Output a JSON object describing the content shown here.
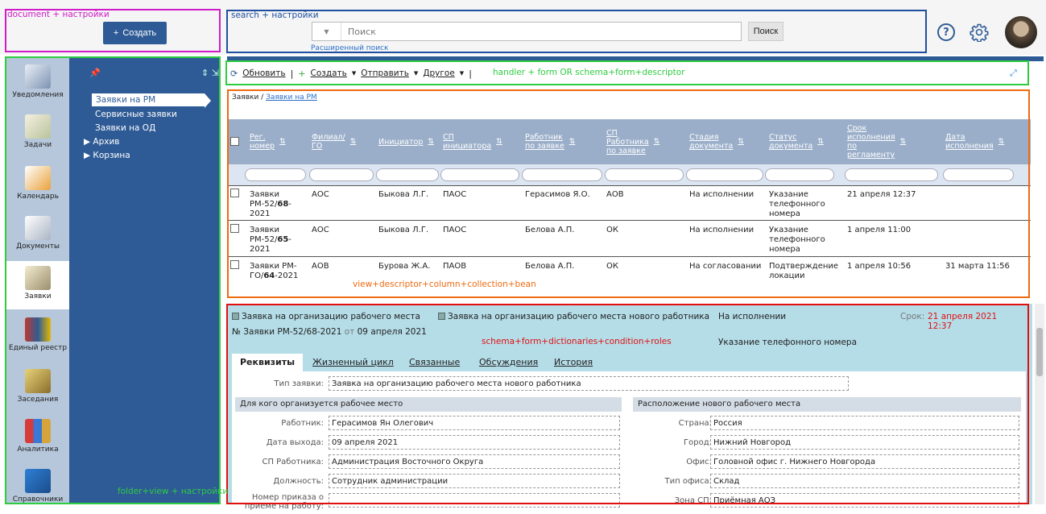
{
  "annotations": {
    "document": "document + настройки",
    "search": "search + настройки",
    "handler": "handler + form OR schema+form+descriptor",
    "folder": "folder+view + настройки",
    "view": "view+descriptor+column+collection+bean",
    "schema": "schema+form+dictionaries+condition+roles"
  },
  "header": {
    "create_label": "Создать",
    "search_placeholder": "Поиск",
    "search_button": "Поиск",
    "advanced_search": "Расширенный поиск",
    "help_glyph": "?"
  },
  "sidebar": {
    "items": [
      {
        "label": "Уведомления",
        "icon": "megaphone-icon"
      },
      {
        "label": "Задачи",
        "icon": "tasks-icon"
      },
      {
        "label": "Календарь",
        "icon": "calendar-icon"
      },
      {
        "label": "Документы",
        "icon": "documents-icon"
      },
      {
        "label": "Заявки",
        "icon": "requests-icon"
      },
      {
        "label": "Единый реестр",
        "icon": "registry-icon"
      },
      {
        "label": "Заседания",
        "icon": "meetings-icon"
      },
      {
        "label": "Аналитика",
        "icon": "analytics-icon"
      },
      {
        "label": "Справочники",
        "icon": "handbook-icon"
      }
    ]
  },
  "tree": {
    "items": [
      "Заявки на РМ",
      "Сервисные заявки",
      "Заявки на ОД",
      "Архив",
      "Корзина"
    ],
    "pin": "📌",
    "collapse": "⇕ ⇲"
  },
  "toolbar": {
    "refresh": "Обновить",
    "create": "Создать",
    "send": "Отправить",
    "other": "Другое",
    "sep": "|"
  },
  "breadcrumb": {
    "root": "Заявки",
    "sep": "/",
    "current": "Заявки на РМ"
  },
  "grid": {
    "columns": [
      "Рег.\nномер",
      "Филиал/\nГО",
      "Инициатор",
      "СП\nинициатора",
      "Работник\nпо заявке",
      "СП\nРаботника\nпо заявке",
      "Стадия\nдокумента",
      "Статус\nдокумента",
      "Срок\nисполнения\nпо\nрегламенту",
      "Дата\nисполнения"
    ],
    "rows": [
      {
        "num_pre": "Заявки\nРМ-52/",
        "num_bold": "68",
        "num_post": "-\n2021",
        "branch": "АОС",
        "initiator": "Быкова Л.Г.",
        "sp_init": "ПАОС",
        "worker": "Герасимов Я.О.",
        "sp_worker": "АОВ",
        "stage": "На исполнении",
        "status": "Указание\nтелефонного\nномера",
        "deadline": "21 апреля 12:37",
        "done": ""
      },
      {
        "num_pre": "Заявки\nРМ-52/",
        "num_bold": "65",
        "num_post": "-\n2021",
        "branch": "АОС",
        "initiator": "Быкова Л.Г.",
        "sp_init": "ПАОС",
        "worker": "Белова А.П.",
        "sp_worker": "ОК",
        "stage": "На исполнении",
        "status": "Указание\nтелефонного\nномера",
        "deadline": "1 апреля 11:00",
        "done": ""
      },
      {
        "num_pre": "Заявки РМ-\nГО/",
        "num_bold": "64",
        "num_post": "-2021",
        "branch": "АОВ",
        "initiator": "Бурова Ж.А.",
        "sp_init": "ПАОВ",
        "worker": "Белова А.П.",
        "sp_worker": "ОК",
        "stage": "На согласовании",
        "status": "Подтверждение\nлокации",
        "deadline": "1 апреля 10:56",
        "done": "31 марта 11:56"
      }
    ]
  },
  "detail": {
    "type1": "Заявка на организацию рабочего места",
    "type2": "Заявка на организацию рабочего места нового работника",
    "state": "На исполнении",
    "deadline_label": "Срок:",
    "deadline_value": "21 апреля 2021\n12:37",
    "number": "№ Заявки РМ-52/68-2021",
    "from": "от",
    "date": "09 апреля 2021",
    "status_text": "Указание телефонного номера",
    "tabs": [
      "Реквизиты",
      "Жизненный цикл",
      "Связанные",
      "Обсуждения",
      "История"
    ],
    "request_type_label": "Тип заявки:",
    "request_type_value": "Заявка на организацию рабочего места нового работника",
    "left_section": "Для кого организуется рабочее место",
    "right_section": "Расположение нового рабочего места",
    "left_fields": [
      {
        "label": "Работник:",
        "value": "Герасимов Ян Олегович"
      },
      {
        "label": "Дата выхода:",
        "value": "09 апреля 2021"
      },
      {
        "label": "СП Работника:",
        "value": "Администрация Восточного Округа"
      },
      {
        "label": "Должность:",
        "value": "Сотрудник администрации"
      },
      {
        "label": "Номер приказа о\nприеме на работу:",
        "value": ""
      }
    ],
    "right_fields": [
      {
        "label": "Страна:",
        "value": "Россия"
      },
      {
        "label": "Город:",
        "value": "Нижний Новгород"
      },
      {
        "label": "Офис:",
        "value": "Головной офис г. Нижнего Новгорода"
      },
      {
        "label": "Тип офиса:",
        "value": "Склад"
      },
      {
        "label": "Зона СП:",
        "value": "Приёмная АОЗ"
      }
    ]
  },
  "colors": {
    "brand": "#2e5b96",
    "annotation_magenta": "#d01cc8",
    "annotation_blue": "#1f4fa0",
    "annotation_green": "#2ecc40",
    "annotation_orange": "#ee6a10",
    "annotation_red": "#e01010",
    "deadline_red": "#e01010"
  }
}
